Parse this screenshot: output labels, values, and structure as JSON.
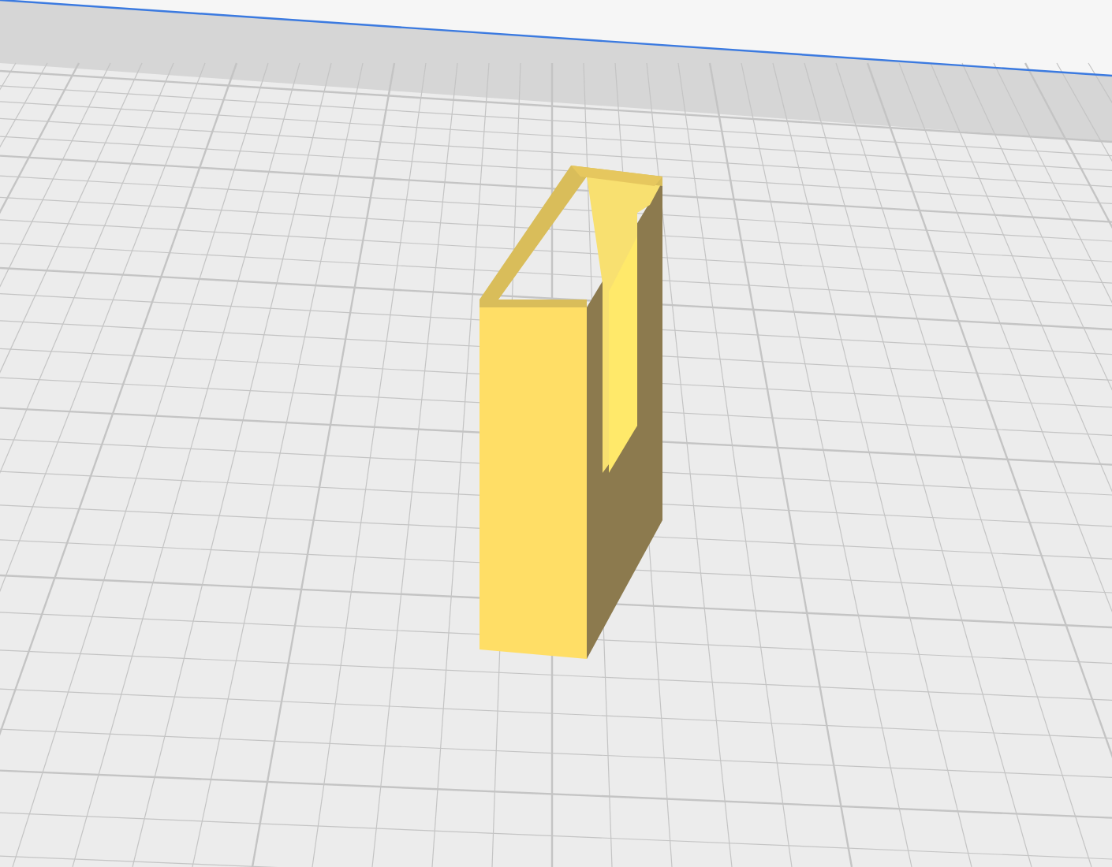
{
  "viewport": {
    "kind": "build-plate",
    "model": {
      "kind": "holder"
    }
  }
}
